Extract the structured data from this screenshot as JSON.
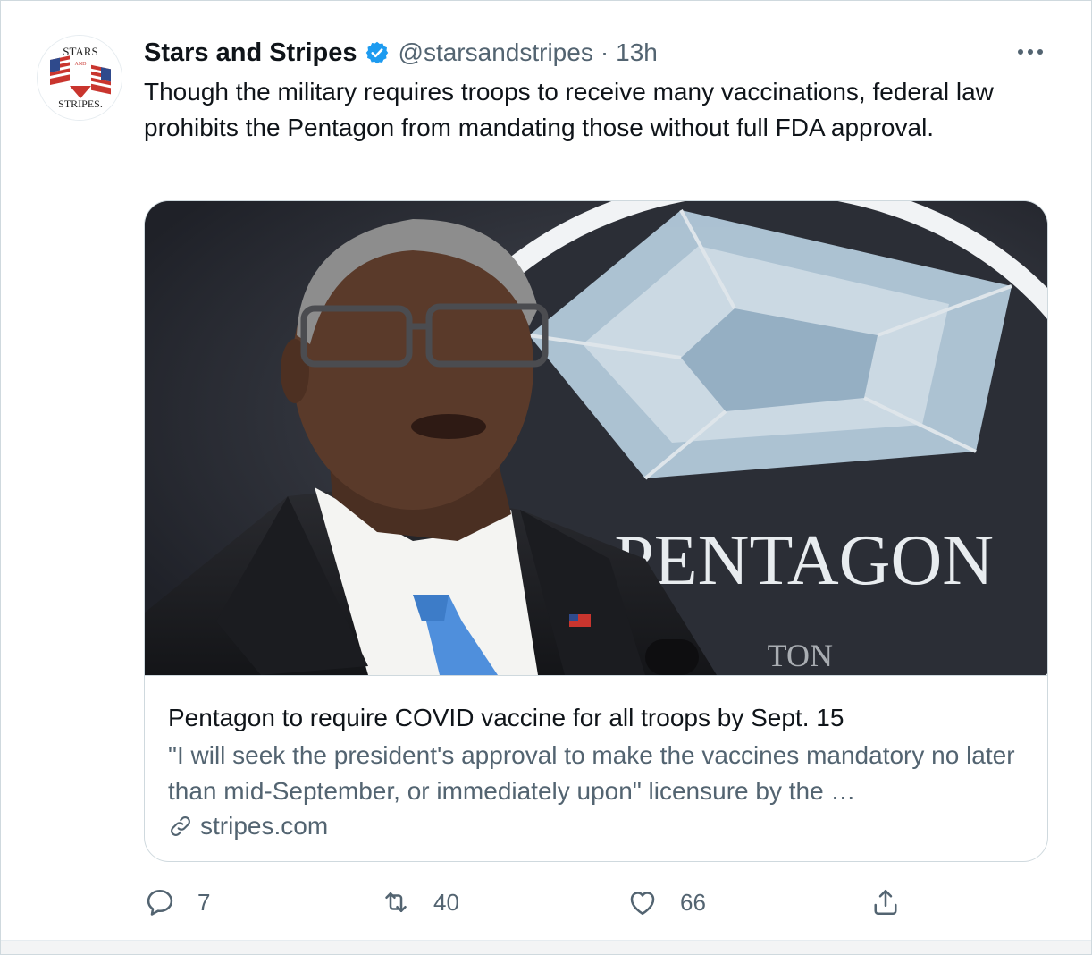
{
  "tweet": {
    "display_name": "Stars and Stripes",
    "handle": "@starsandstripes",
    "separator": "·",
    "time": "13h",
    "verified": true,
    "text": "Though the military requires troops to receive many vaccinations, federal law prohibits the Pentagon from mandating those without full FDA approval.",
    "avatar": {
      "logo_text_top": "STARS",
      "logo_text_mid": "AND",
      "logo_text_bottom": "STRIPES."
    }
  },
  "card": {
    "image": {
      "sign_text": "PENTAGON",
      "sign_subtext": "TON"
    },
    "title": "Pentagon to require COVID vaccine for all troops by Sept. 15",
    "description": "\"I will seek the president's approval to make the vaccines mandatory no later than mid-September, or immediately upon\" licensure by the …",
    "domain": "stripes.com"
  },
  "actions": {
    "reply_count": "7",
    "retweet_count": "40",
    "like_count": "66"
  },
  "colors": {
    "text_primary": "#0f1419",
    "text_secondary": "#536471",
    "verified_blue": "#1d9bf0",
    "border": "#cfd9de"
  },
  "icons": [
    "verified-badge-icon",
    "more-icon",
    "link-icon",
    "reply-icon",
    "retweet-icon",
    "like-icon",
    "share-icon"
  ]
}
